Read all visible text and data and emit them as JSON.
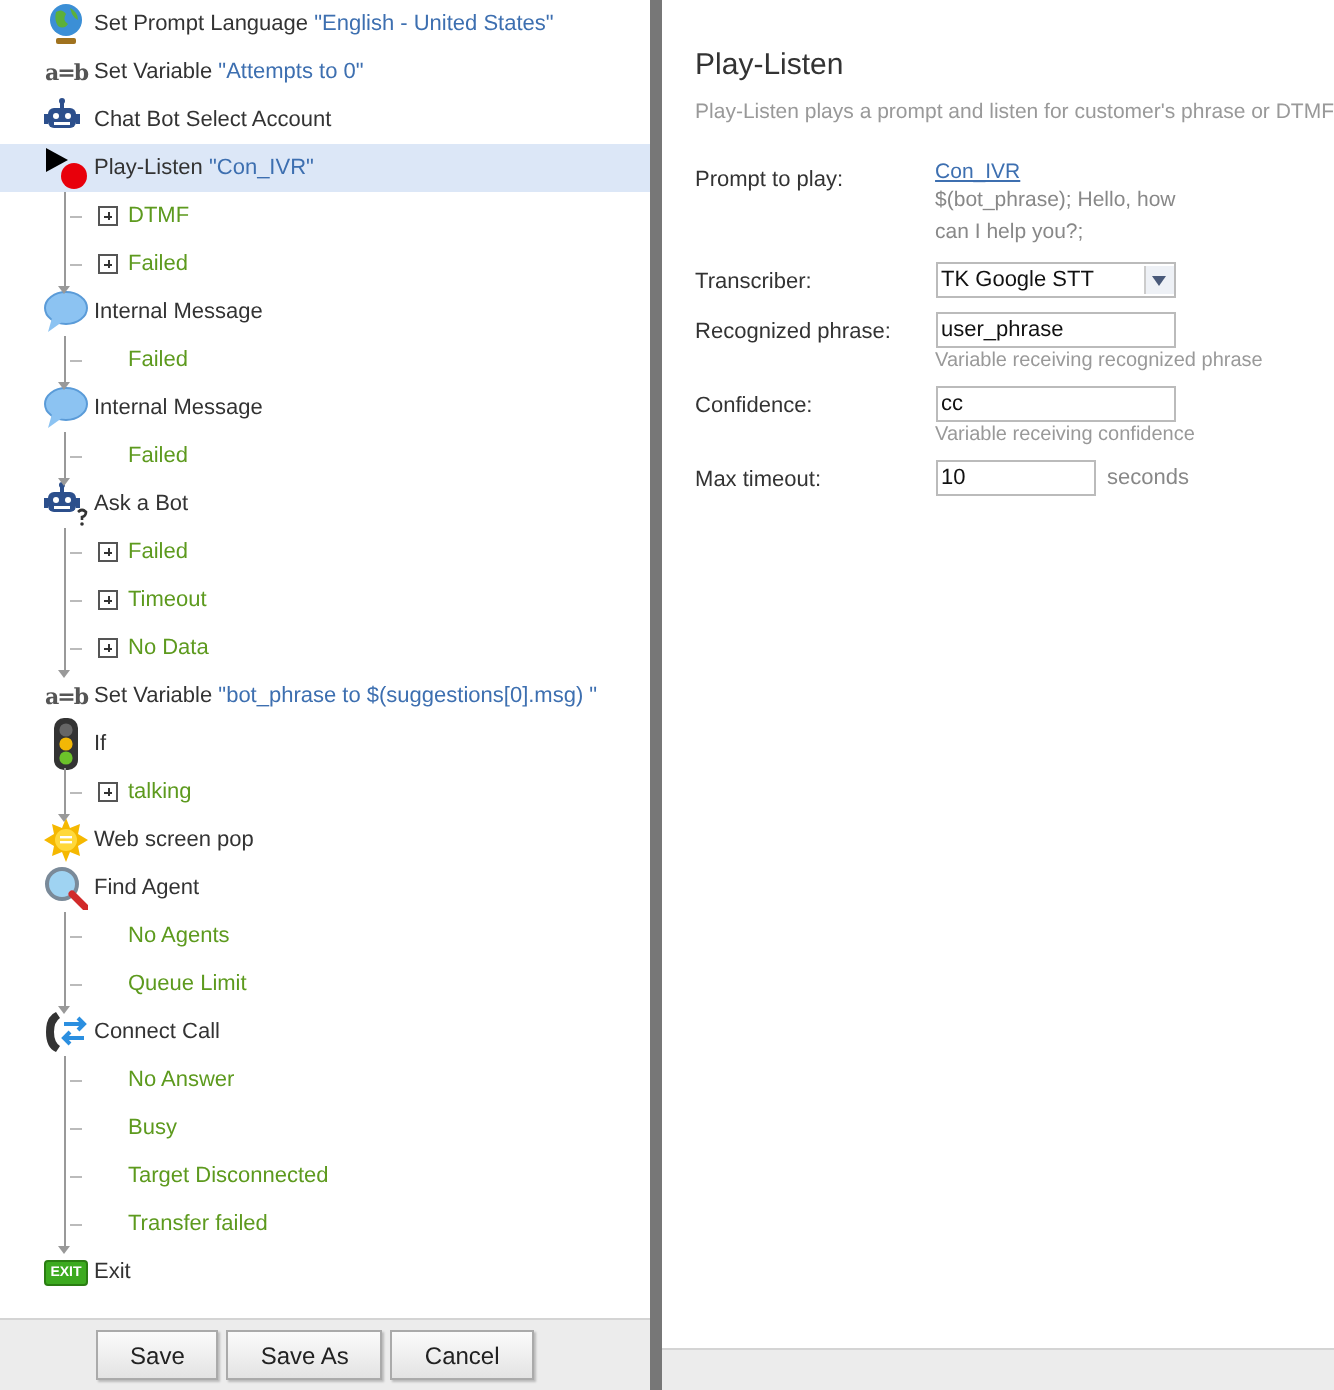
{
  "flow": {
    "steps": [
      {
        "kind": "globe",
        "label": "Set Prompt Language",
        "value": "\"English - United States\"",
        "selected": false
      },
      {
        "kind": "variable",
        "icon_text": "a=b",
        "label": "Set Variable",
        "value": "\"Attempts to 0\"",
        "selected": false
      },
      {
        "kind": "robot",
        "label": "Chat Bot Select Account",
        "selected": false
      },
      {
        "kind": "play",
        "label": "Play-Listen",
        "value": "\"Con_IVR\"",
        "selected": true,
        "branches": [
          {
            "label": "DTMF",
            "expandable": true
          },
          {
            "label": "Failed",
            "expandable": true
          }
        ]
      },
      {
        "kind": "bubble",
        "label": "Internal Message",
        "selected": false,
        "branches": [
          {
            "label": "Failed",
            "expandable": false
          }
        ]
      },
      {
        "kind": "bubble",
        "label": "Internal Message",
        "selected": false,
        "branches": [
          {
            "label": "Failed",
            "expandable": false
          }
        ]
      },
      {
        "kind": "robot-question",
        "label": "Ask a Bot",
        "selected": false,
        "branches": [
          {
            "label": "Failed",
            "expandable": true
          },
          {
            "label": "Timeout",
            "expandable": true
          },
          {
            "label": "No Data",
            "expandable": true
          }
        ]
      },
      {
        "kind": "variable",
        "icon_text": "a=b",
        "label": "Set Variable",
        "value": "\"bot_phrase to $(suggestions[0].msg) \"",
        "selected": false
      },
      {
        "kind": "traffic",
        "label": "If",
        "selected": false,
        "branches": [
          {
            "label": "talking",
            "expandable": true
          }
        ]
      },
      {
        "kind": "sun",
        "label": "Web screen pop",
        "selected": false
      },
      {
        "kind": "magnifier",
        "label": "Find Agent",
        "selected": false,
        "branches": [
          {
            "label": "No Agents",
            "expandable": false
          },
          {
            "label": "Queue Limit",
            "expandable": false
          }
        ]
      },
      {
        "kind": "phone",
        "label": "Connect Call",
        "selected": false,
        "branches": [
          {
            "label": "No Answer",
            "expandable": false
          },
          {
            "label": "Busy",
            "expandable": false
          },
          {
            "label": "Target Disconnected",
            "expandable": false
          },
          {
            "label": "Transfer failed",
            "expandable": false
          }
        ]
      },
      {
        "kind": "exit",
        "icon_text": "EXIT",
        "label": "Exit",
        "selected": false
      }
    ]
  },
  "buttons": [
    "Save",
    "Save As",
    "Cancel"
  ],
  "properties": {
    "title": "Play-Listen",
    "description": "Play-Listen plays a prompt and listen for customer's phrase or DTMF",
    "fields": [
      {
        "kind": "prompt",
        "label": "Prompt to play:",
        "link": "Con_IVR",
        "text": "$(bot_phrase); Hello, how can I help you?;"
      },
      {
        "kind": "select",
        "label": "Transcriber:",
        "value": "TK Google STT"
      },
      {
        "kind": "input",
        "label": "Recognized phrase:",
        "value": "user_phrase",
        "hint": "Variable receiving recognized phrase"
      },
      {
        "kind": "input",
        "label": "Confidence:",
        "value": "cc",
        "hint": "Variable receiving confidence"
      },
      {
        "kind": "short-input",
        "label": "Max timeout:",
        "value": "10",
        "unit": "seconds"
      }
    ]
  }
}
